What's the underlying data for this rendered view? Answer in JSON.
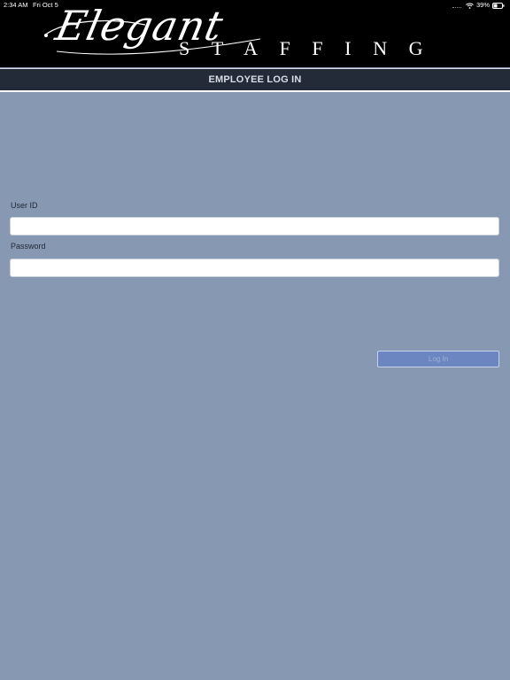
{
  "status_bar": {
    "time": "2:34 AM",
    "date": "Fri Oct 5",
    "battery": "39%",
    "icons": [
      "cellular-signal-icon",
      "wifi-icon",
      "battery-icon"
    ]
  },
  "logo": {
    "script_text": "Elegant",
    "block_text": "STAFFING"
  },
  "title_bar": {
    "title": "EMPLOYEE LOG IN"
  },
  "form": {
    "user_id_label": "User ID",
    "user_id_value": "",
    "password_label": "Password",
    "password_value": "",
    "login_label": "Log In"
  },
  "colors": {
    "background": "#8798b2",
    "header": "#000000",
    "title_bar": "#232b38",
    "button": "#6b86c0"
  }
}
